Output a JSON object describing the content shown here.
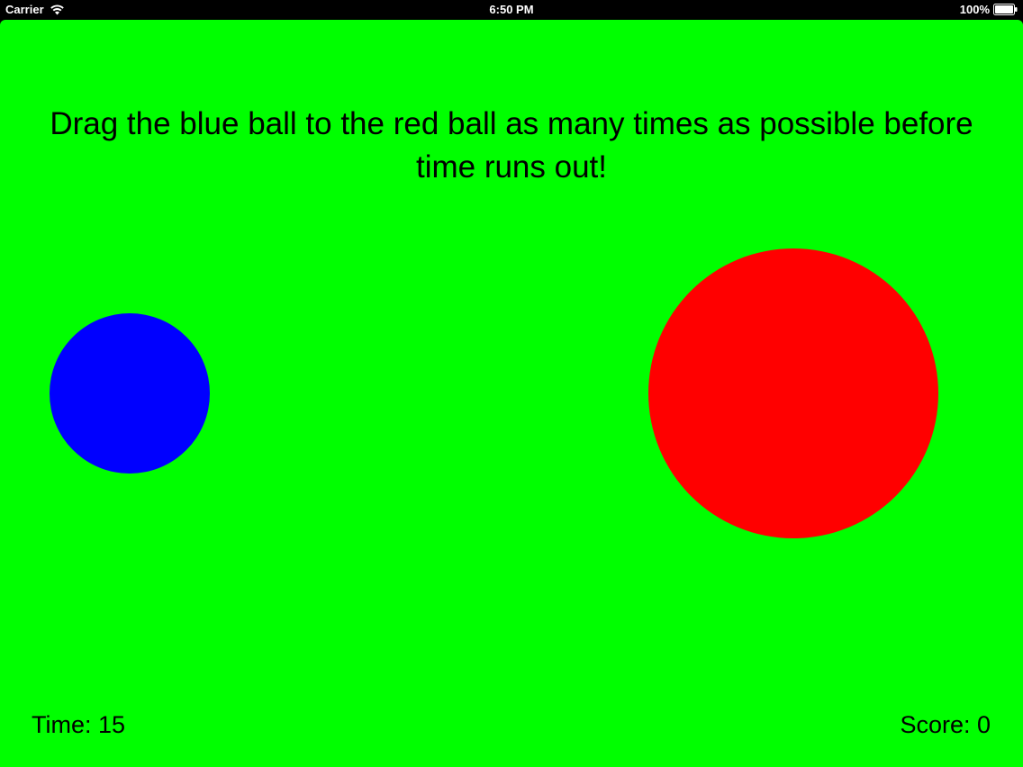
{
  "status_bar": {
    "carrier": "Carrier",
    "time": "6:50 PM",
    "battery": "100%",
    "wifi_icon": "wifi-icon",
    "battery_icon": "battery-icon"
  },
  "game": {
    "instructions": "Drag the blue ball to the red ball as many times as possible before time runs out!",
    "time_text": "Time: 15",
    "score_text": "Score: 0",
    "colors": {
      "background": "#00ff00",
      "blue_ball": "#0000ff",
      "red_ball": "#ff0000",
      "text": "#000000"
    }
  }
}
